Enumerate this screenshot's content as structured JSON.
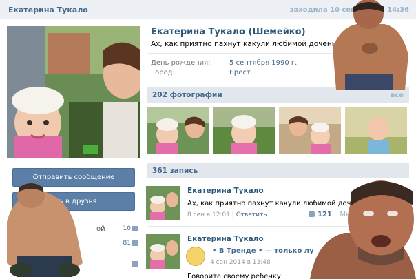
{
  "header": {
    "name": "Екатерина Тукало",
    "last_seen": "заходила 10 сентября в 14:36"
  },
  "profile": {
    "full_name": "Екатерина Тукало (Шемейко)",
    "status": "Ах, как приятно пахнут какули любимой доченьки!))",
    "birthday_label": "День рождения:",
    "birthday_value": "5 сентября 1990 г.",
    "city_label": "Город:",
    "city_value": "Брест"
  },
  "left": {
    "avatar_name": "Екатерина Тукало",
    "send_message": "Отправить сообщение",
    "add_friend": "ить в друзья",
    "stats": [
      {
        "label": "ой",
        "count": "10"
      },
      {
        "label": "",
        "count": "81"
      }
    ]
  },
  "photos": {
    "title": "202 фотографии",
    "all_label": "все"
  },
  "wall": {
    "title": "361 запись",
    "posts": [
      {
        "author": "Екатерина Тукало",
        "text": "Ах, как приятно пахнут какули любимой доченьки!))",
        "date": "8 сен в 12:01",
        "reply": "Ответить",
        "likes": "121",
        "more": "Мне нр"
      },
      {
        "author": "Екатерина Тукало",
        "trend": "• В Тренде • — только лу",
        "date": "4 сен 2014 в 13:48",
        "text": "Говорите своему ребенку:"
      }
    ]
  },
  "colors": {
    "link": "#45688e",
    "bar": "#e1e7ed",
    "button": "#5b7fa6"
  }
}
